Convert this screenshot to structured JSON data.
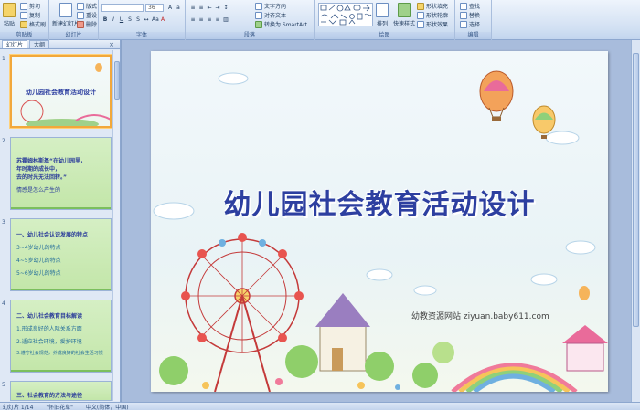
{
  "ribbon": {
    "groups": [
      {
        "label": "剪贴板"
      },
      {
        "label": "幻灯片"
      },
      {
        "label": "字体"
      },
      {
        "label": "段落"
      },
      {
        "label": "绘图"
      },
      {
        "label": "编辑"
      }
    ],
    "paste": "粘贴",
    "cut": "剪切",
    "copy": "复制",
    "format_painter": "格式刷",
    "new_slide": "新建幻灯片",
    "layout": "版式",
    "reset": "重设",
    "delete": "删除",
    "font_name": "",
    "font_size": "36",
    "text_direction": "文字方向",
    "align_text": "对齐文本",
    "smartart": "转换为 SmartArt",
    "arrange": "排列",
    "quick_styles": "快速样式",
    "shape_fill": "形状填充",
    "shape_outline": "形状轮廓",
    "shape_effects": "形状效果",
    "find": "查找",
    "replace": "替换",
    "select": "选择"
  },
  "left_panel": {
    "tabs": [
      "幻灯片",
      "大纲"
    ],
    "slides": [
      {
        "num": "1",
        "title": "幼儿园社会教育活动设计"
      },
      {
        "num": "2",
        "lines": [
          "苏霍姆林斯基“在幼儿园里，",
          "年时期的成长中，",
          "去的时光无法回转。”",
          "情感是怎么产生的"
        ]
      },
      {
        "num": "3",
        "lines": [
          "一、幼儿社会认识发展的特点",
          "3~4岁幼儿的特点",
          "4~5岁幼儿的特点",
          "5~6岁幼儿的特点"
        ]
      },
      {
        "num": "4",
        "lines": [
          "二、幼儿社会教育目标解读",
          "1.形成良好的人际关系方面",
          "2.适应社会环境，爱护环境",
          "3.遵守社会规范，养成良好的社会生活习惯"
        ]
      },
      {
        "num": "5",
        "lines": [
          "三、社会教育的方法与途径"
        ]
      }
    ]
  },
  "slide": {
    "title": "幼儿园社会教育活动设计",
    "watermark": "幼教资源网站  ziyuan.baby611.com"
  },
  "status": {
    "slide_count": "幻灯片 1/14",
    "theme": "\"怀旧花草\"",
    "language": "中文(简体，中国)"
  },
  "colors": {
    "title": "#2d3fa0",
    "ribbon_bg": "#d3e1f3",
    "selected_border": "#f2a83b"
  }
}
